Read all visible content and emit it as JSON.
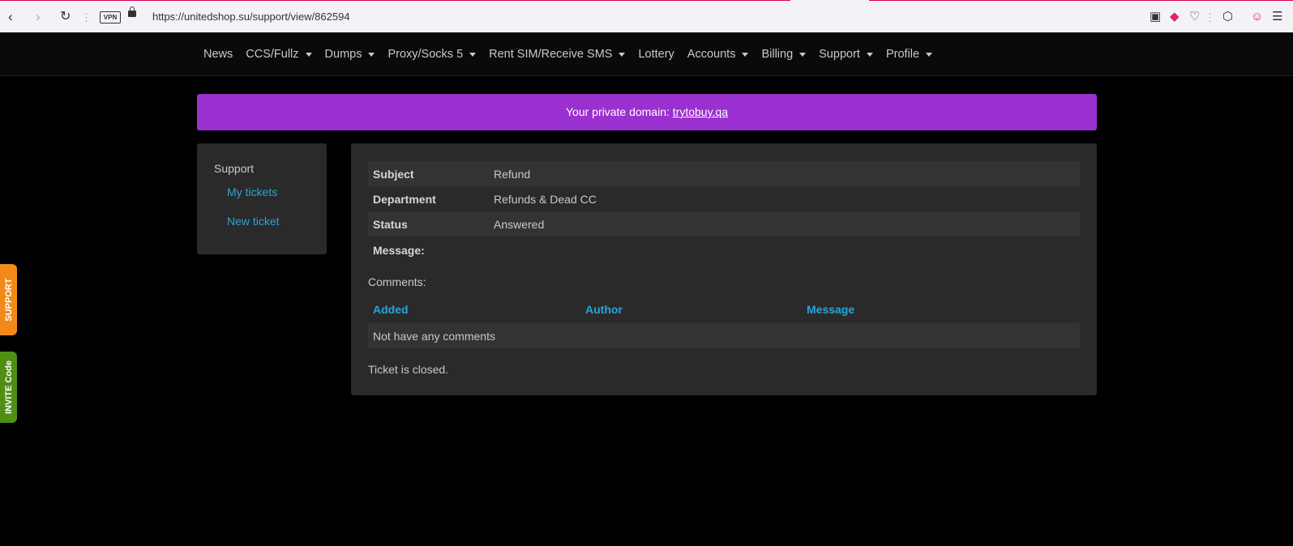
{
  "browser": {
    "url": "https://unitedshop.su/support/view/862594",
    "vpn_label": "VPN"
  },
  "nav": {
    "items": [
      {
        "label": "News",
        "dropdown": false
      },
      {
        "label": "CCS/Fullz",
        "dropdown": true
      },
      {
        "label": "Dumps",
        "dropdown": true
      },
      {
        "label": "Proxy/Socks 5",
        "dropdown": true
      },
      {
        "label": "Rent SIM/Receive SMS",
        "dropdown": true
      },
      {
        "label": "Lottery",
        "dropdown": false
      },
      {
        "label": "Accounts",
        "dropdown": true
      },
      {
        "label": "Billing",
        "dropdown": true
      },
      {
        "label": "Support",
        "dropdown": true
      },
      {
        "label": "Profile",
        "dropdown": true
      }
    ]
  },
  "banner": {
    "text": "Your private domain: ",
    "domain": "trytobuy.qa",
    "color": "#9b30d0"
  },
  "sidebar": {
    "title": "Support",
    "links": [
      "My tickets",
      "New ticket"
    ]
  },
  "ticket": {
    "subject_label": "Subject",
    "subject": "Refund",
    "department_label": "Department",
    "department": "Refunds & Dead CC",
    "status_label": "Status",
    "status": "Answered",
    "message_label": "Message:"
  },
  "comments": {
    "label": "Comments:",
    "columns": [
      "Added",
      "Author",
      "Message"
    ],
    "empty_text": "Not have any comments"
  },
  "closed_text": "Ticket is closed.",
  "side_tabs": {
    "support": "SUPPORT",
    "invite": "INVITE Code"
  },
  "colors": {
    "accent_link": "#2aa4d8",
    "support_tab": "#f28a1a",
    "invite_tab": "#4f8f14"
  }
}
